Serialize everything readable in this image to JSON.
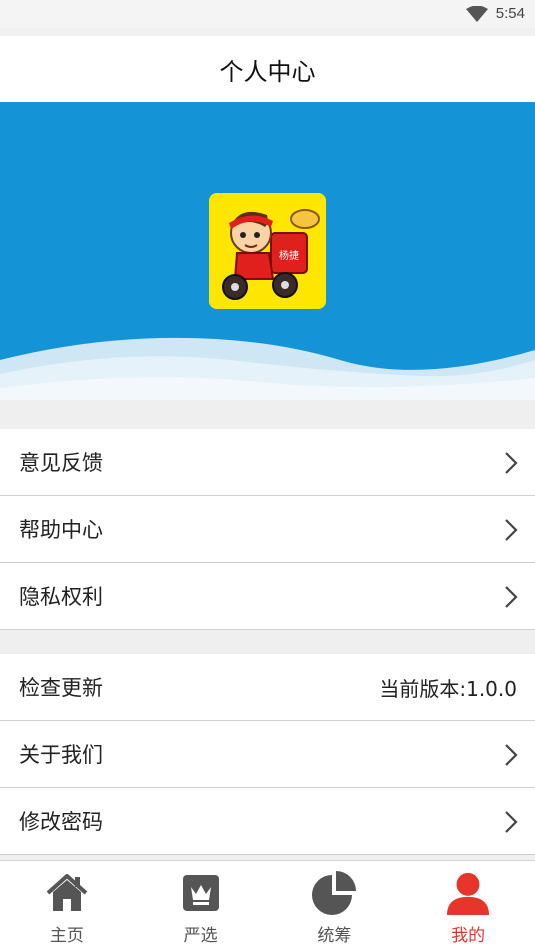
{
  "status_bar": {
    "time": "5:54"
  },
  "header": {
    "title": "个人中心"
  },
  "banner": {
    "logo_text": "杨捷"
  },
  "menu_group_1": [
    {
      "label": "意见反馈"
    },
    {
      "label": "帮助中心"
    },
    {
      "label": "隐私权利"
    }
  ],
  "menu_group_2": {
    "check_update": {
      "label": "检查更新",
      "value": "当前版本:1.0.0"
    },
    "about": {
      "label": "关于我们"
    },
    "change_password": {
      "label": "修改密码"
    }
  },
  "tabbar": {
    "tabs": [
      {
        "label": "主页",
        "icon": "home-icon"
      },
      {
        "label": "严选",
        "icon": "crown-icon"
      },
      {
        "label": "统筹",
        "icon": "pie-chart-icon"
      },
      {
        "label": "我的",
        "icon": "user-icon",
        "active": true
      }
    ],
    "active_color": "#e8352c",
    "inactive_color": "#555555"
  },
  "colors": {
    "banner": "#1494d6",
    "logo_bg": "#ffe600"
  }
}
